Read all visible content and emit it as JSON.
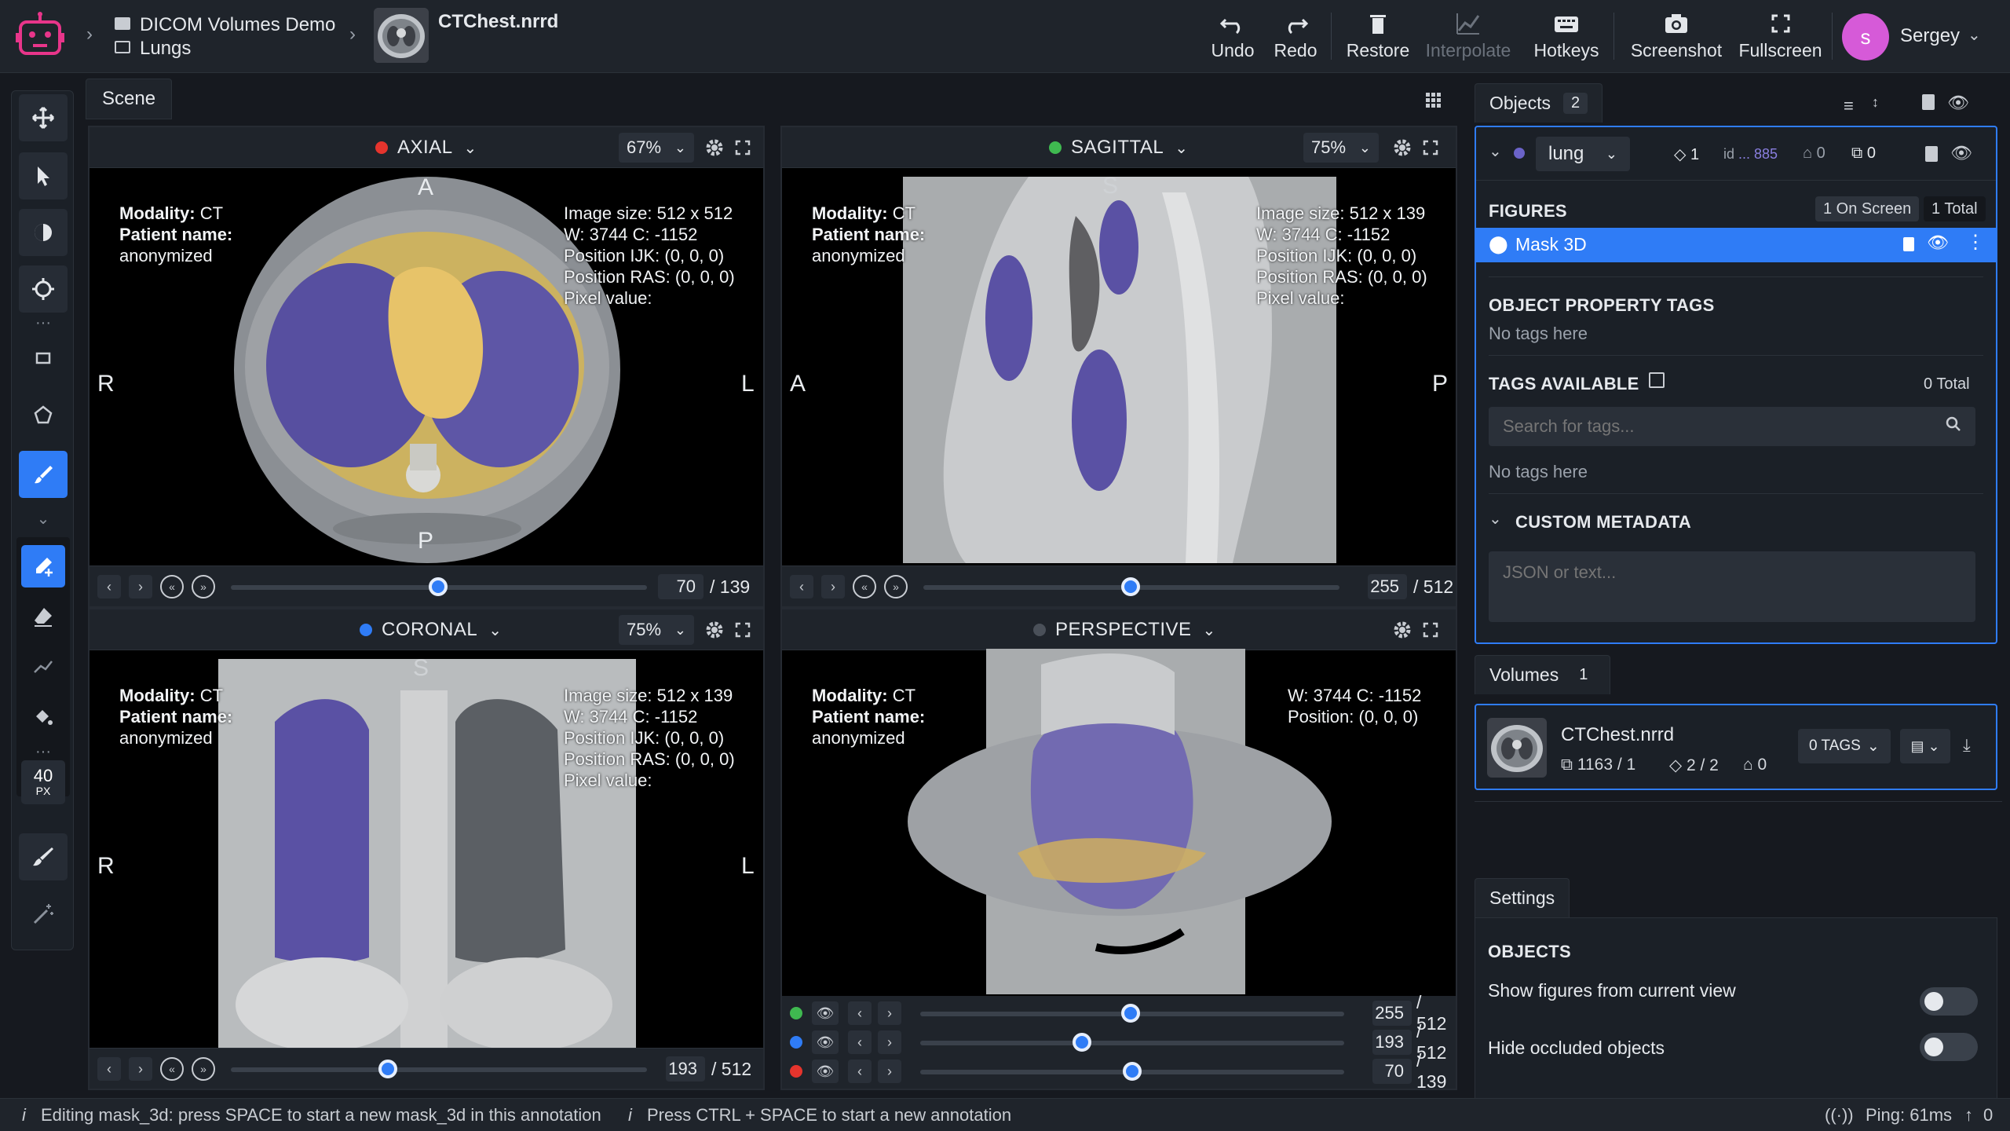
{
  "topbar": {
    "project": "DICOM Volumes Demo",
    "dataset": "Lungs",
    "file": "CTChest.nrrd",
    "buttons": {
      "undo": "Undo",
      "redo": "Redo",
      "restore": "Restore",
      "interpolate": "Interpolate",
      "hotkeys": "Hotkeys",
      "screenshot": "Screenshot",
      "fullscreen": "Fullscreen"
    },
    "user_initial": "s",
    "user_name": "Sergey"
  },
  "tools": {
    "brush_size_value": "40",
    "brush_size_unit": "PX"
  },
  "scene": {
    "tab": "Scene",
    "axial": {
      "title": "AXIAL",
      "zoom": "67%",
      "slice": "70",
      "total": "/ 139",
      "top": "A",
      "bottom": "P",
      "left": "R",
      "right": "L",
      "modality_label": "Modality:",
      "modality": "CT",
      "patient_label": "Patient name:",
      "patient": "anonymized",
      "info": [
        "Image size: 512 x 512",
        "W: 3744 C: -1152",
        "Position IJK: (0, 0, 0)",
        "Position RAS: (0, 0, 0)",
        "Pixel value:"
      ]
    },
    "sagittal": {
      "title": "SAGITTAL",
      "zoom": "75%",
      "slice": "255",
      "total": "/ 512",
      "top": "S",
      "left": "A",
      "right": "P",
      "modality_label": "Modality:",
      "modality": "CT",
      "patient_label": "Patient name:",
      "patient": "anonymized",
      "info": [
        "Image size: 512 x 139",
        "W: 3744 C: -1152",
        "Position IJK: (0, 0, 0)",
        "Position RAS: (0, 0, 0)",
        "Pixel value:"
      ]
    },
    "coronal": {
      "title": "CORONAL",
      "zoom": "75%",
      "slice": "193",
      "total": "/ 512",
      "top": "S",
      "left": "R",
      "right": "L",
      "modality_label": "Modality:",
      "modality": "CT",
      "patient_label": "Patient name:",
      "patient": "anonymized",
      "info": [
        "Image size: 512 x 139",
        "W: 3744 C: -1152",
        "Position IJK: (0, 0, 0)",
        "Position RAS: (0, 0, 0)",
        "Pixel value:"
      ]
    },
    "perspective": {
      "title": "PERSPECTIVE",
      "modality_label": "Modality:",
      "modality": "CT",
      "patient_label": "Patient name:",
      "patient": "anonymized",
      "info": [
        "W: 3744 C: -1152",
        "Position: (0, 0, 0)"
      ],
      "rows": [
        {
          "value": "255",
          "total": "/ 512",
          "color": "#3fb950"
        },
        {
          "value": "193",
          "total": "/ 512",
          "color": "#2f7cf6"
        },
        {
          "value": "70",
          "total": "/ 139",
          "color": "#e5342d"
        }
      ]
    }
  },
  "objects": {
    "title": "Objects",
    "count": "2",
    "class_name": "lung",
    "stat_figures": "1",
    "id_label": "id",
    "id_value": "... 885",
    "stat_tags": "0",
    "stat_copies": "0",
    "figures_title": "FIGURES",
    "on_screen": "1 On Screen",
    "total": "1 Total",
    "figure_name": "Mask 3D",
    "prop_tags_title": "OBJECT PROPERTY TAGS",
    "no_tags": "No tags here",
    "tags_available_title": "TAGS AVAILABLE",
    "tags_total": "0 Total",
    "search_placeholder": "Search for tags...",
    "no_tags2": "No tags here",
    "custom_meta_title": "CUSTOM METADATA",
    "meta_placeholder": "JSON or text..."
  },
  "volumes": {
    "title": "Volumes",
    "count": "1",
    "name": "CTChest.nrrd",
    "frames": "1163 / 1",
    "figures": "2 / 2",
    "tags": "0",
    "tags_btn": "0 TAGS"
  },
  "settings": {
    "title": "Settings",
    "section": "OBJECTS",
    "opt1": "Show figures from current view",
    "opt2": "Hide occluded objects"
  },
  "status": {
    "msg1": "Editing mask_3d: press SPACE to start a new mask_3d in this annotation",
    "msg2": "Press CTRL + SPACE to start a new annotation",
    "ping": "Ping: 61ms",
    "up": "0"
  },
  "colors": {
    "accent": "#2f7cf6",
    "axial_dot": "#e5342d",
    "sagittal_dot": "#3fb950",
    "coronal_dot": "#2f7cf6",
    "perspective_dot": "#4a5059",
    "mask_purple": "#6b63c8",
    "mask_yellow": "#d9b65a",
    "avatar": "#d65ad8"
  }
}
